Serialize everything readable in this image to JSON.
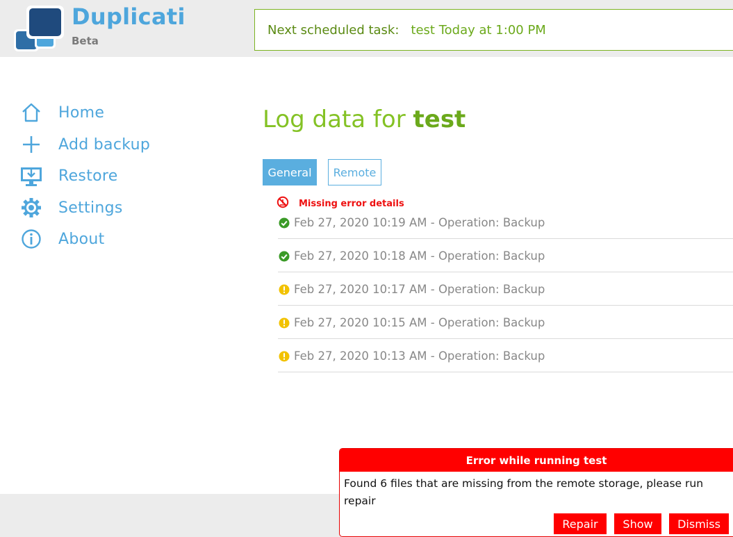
{
  "app": {
    "name": "Duplicati",
    "edition": "Beta"
  },
  "header": {
    "next_task_label": "Next scheduled task:",
    "next_task_value": "test Today at 1:00 PM"
  },
  "sidebar": {
    "items": [
      {
        "label": "Home",
        "icon": "home-icon"
      },
      {
        "label": "Add backup",
        "icon": "plus-icon"
      },
      {
        "label": "Restore",
        "icon": "restore-icon"
      },
      {
        "label": "Settings",
        "icon": "gear-icon"
      },
      {
        "label": "About",
        "icon": "info-icon"
      }
    ]
  },
  "main": {
    "title_prefix": "Log data for",
    "title_name": "test",
    "tabs": [
      {
        "label": "General",
        "active": true
      },
      {
        "label": "Remote",
        "active": false
      }
    ],
    "missing_error_label": "Missing error details",
    "log_entries": [
      {
        "text": "Feb 27, 2020 10:19 AM - Operation: Backup",
        "status": "success"
      },
      {
        "text": "Feb 27, 2020 10:18 AM - Operation: Backup",
        "status": "success"
      },
      {
        "text": "Feb 27, 2020 10:17 AM - Operation: Backup",
        "status": "warning"
      },
      {
        "text": "Feb 27, 2020 10:15 AM - Operation: Backup",
        "status": "warning"
      },
      {
        "text": "Feb 27, 2020 10:13 AM - Operation: Backup",
        "status": "warning"
      }
    ]
  },
  "error_popup": {
    "title": "Error while running test",
    "message": "Found 6 files that are missing from the remote storage, please run repair",
    "buttons": {
      "repair": "Repair",
      "show": "Show",
      "dismiss": "Dismiss"
    }
  },
  "colors": {
    "accent_blue": "#4ea6dc",
    "accent_green": "#84c225",
    "error_red": "#ff0000",
    "success_green": "#3a9a27",
    "warning_yellow": "#f2c200"
  }
}
